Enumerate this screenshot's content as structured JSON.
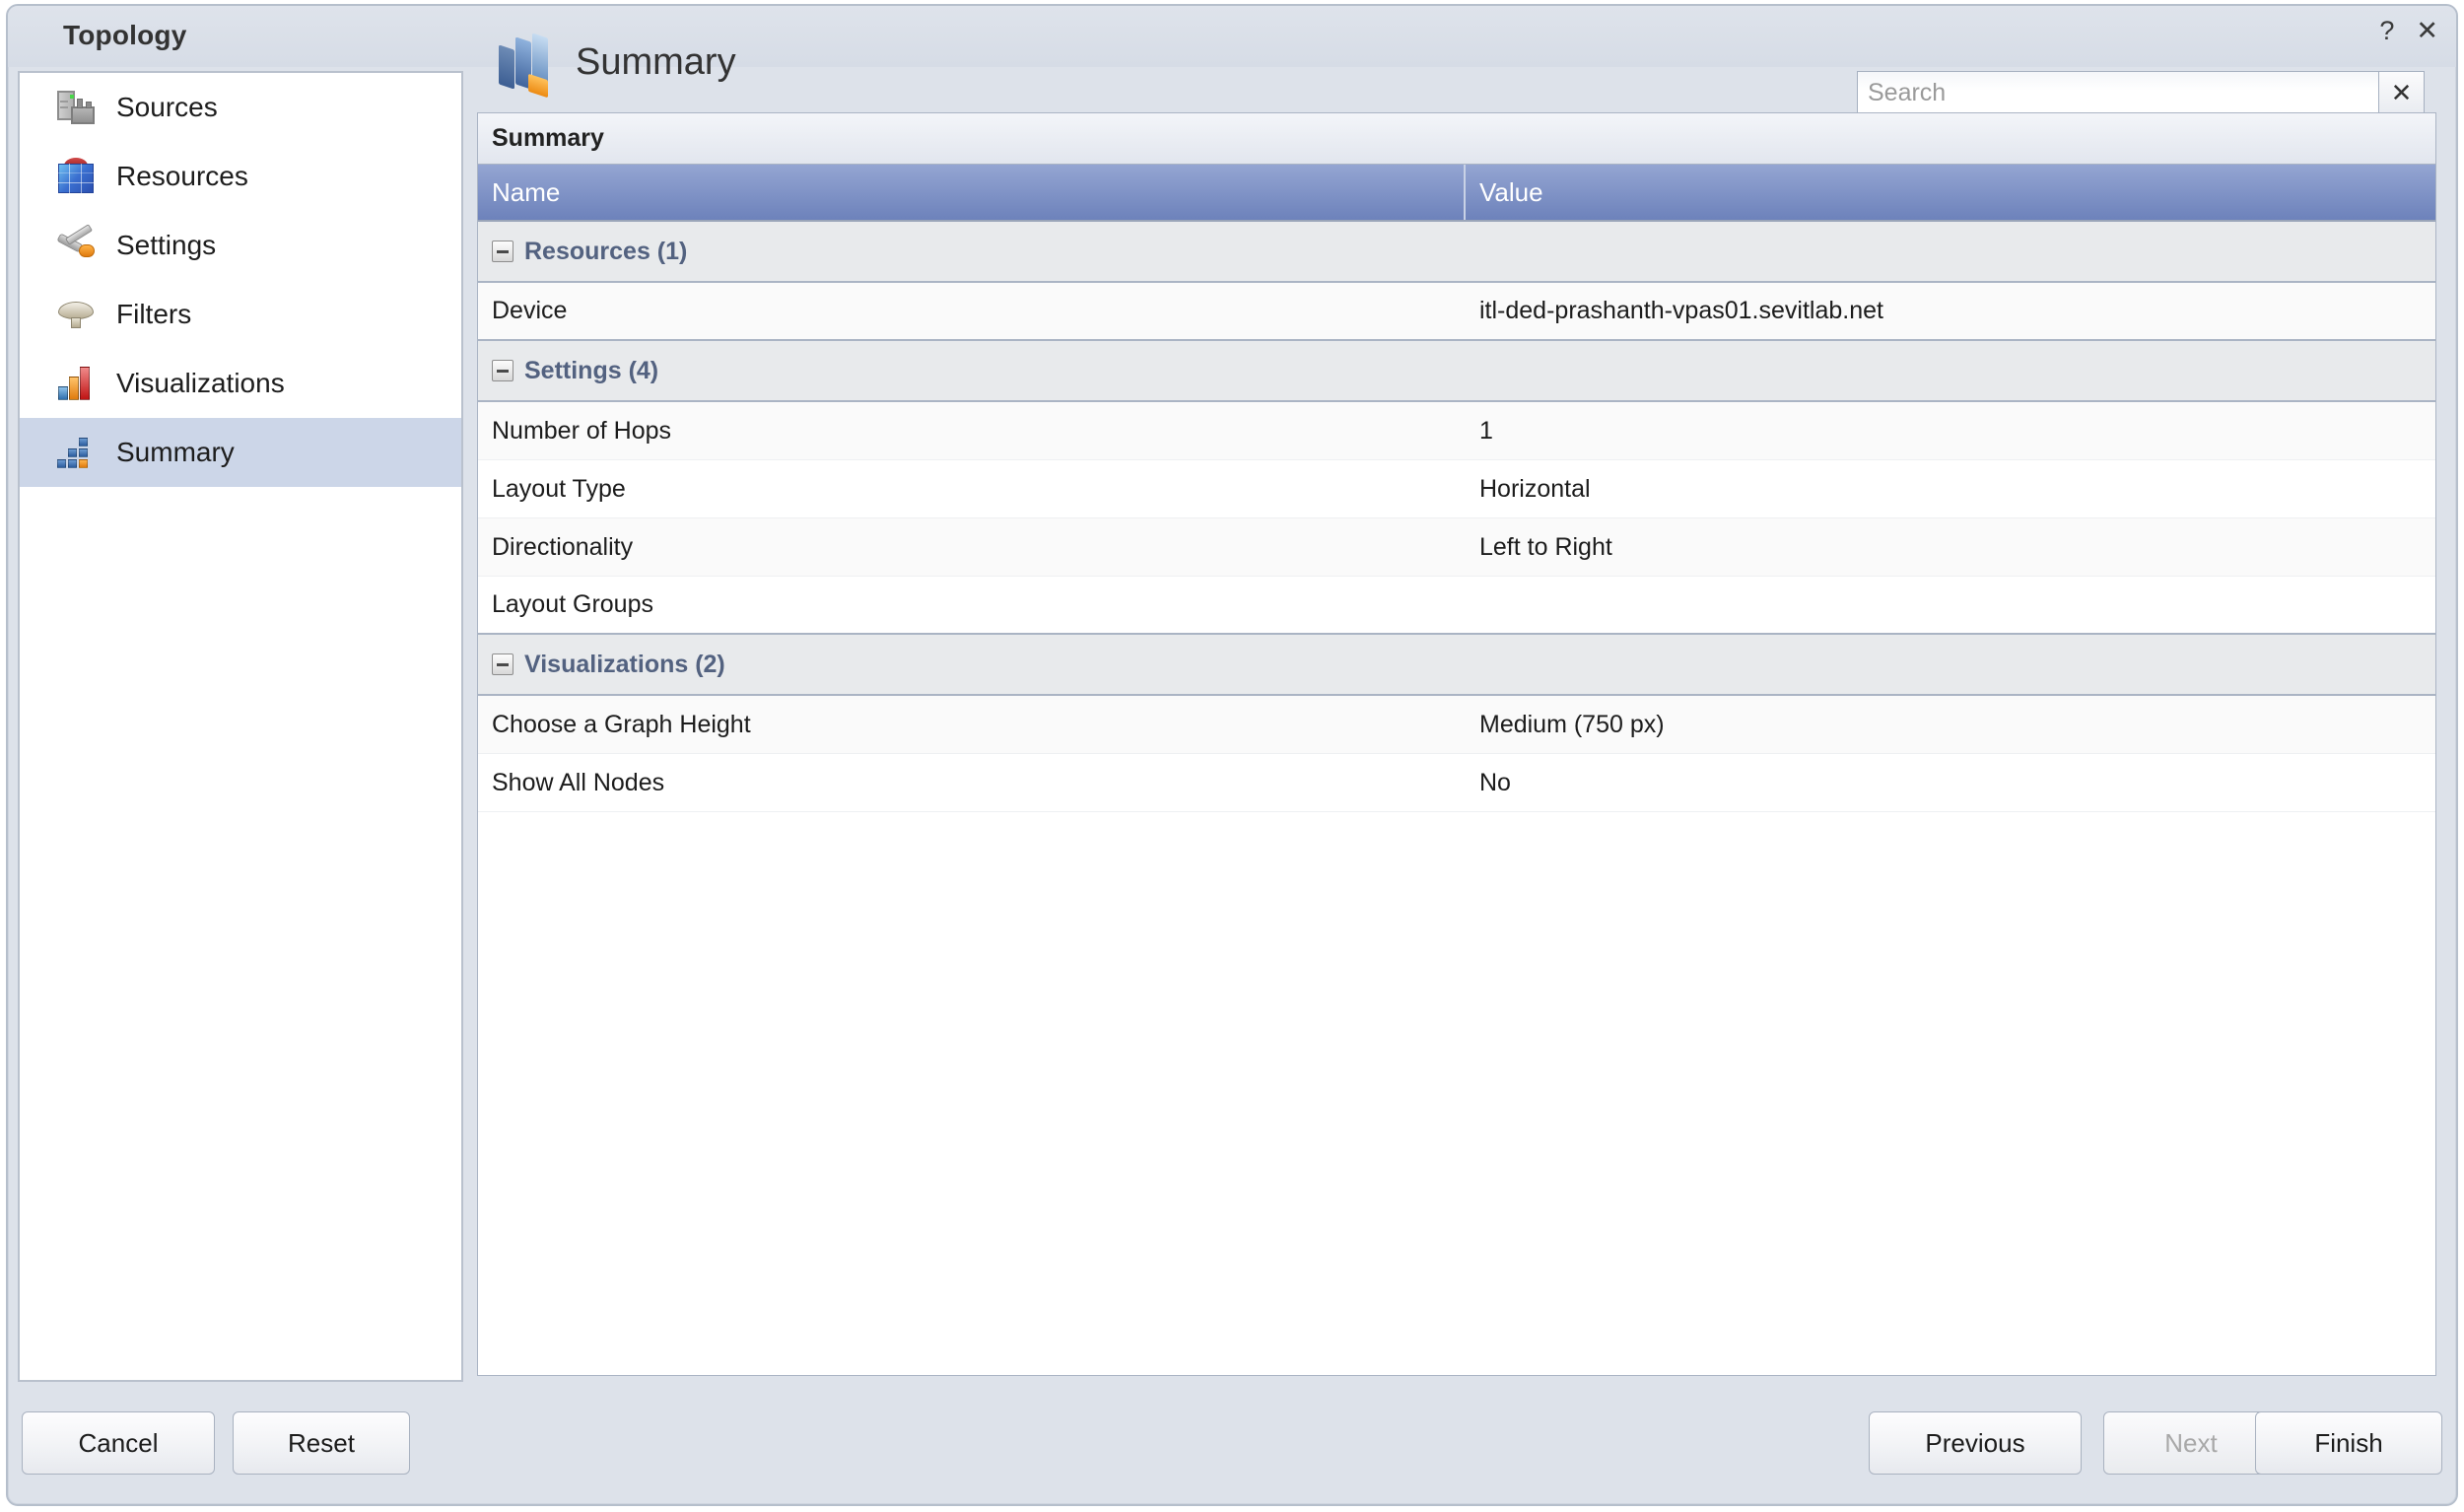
{
  "window": {
    "title": "Topology",
    "help_label": "?",
    "close_label": "✕"
  },
  "sidebar": {
    "items": [
      {
        "label": "Sources",
        "icon": "server-factory-icon",
        "selected": false
      },
      {
        "label": "Resources",
        "icon": "cube-icon",
        "selected": false
      },
      {
        "label": "Settings",
        "icon": "tools-icon",
        "selected": false
      },
      {
        "label": "Filters",
        "icon": "funnel-icon",
        "selected": false
      },
      {
        "label": "Visualizations",
        "icon": "bar-chart-icon",
        "selected": false
      },
      {
        "label": "Summary",
        "icon": "summary-blocks-icon",
        "selected": true
      }
    ]
  },
  "page": {
    "title": "Summary",
    "logo_icon": "topology-shards-icon"
  },
  "search": {
    "placeholder": "Search",
    "value": "",
    "clear_label": "✕"
  },
  "table": {
    "caption": "Summary",
    "columns": [
      "Name",
      "Value"
    ],
    "groups": [
      {
        "label": "Resources (1)",
        "count": 1,
        "rows": [
          {
            "name": "Device",
            "value": "itl-ded-prashanth-vpas01.sevitlab.net"
          }
        ]
      },
      {
        "label": "Settings (4)",
        "count": 4,
        "rows": [
          {
            "name": "Number of Hops",
            "value": "1"
          },
          {
            "name": "Layout Type",
            "value": "Horizontal"
          },
          {
            "name": "Directionality",
            "value": "Left to Right"
          },
          {
            "name": "Layout Groups",
            "value": ""
          }
        ]
      },
      {
        "label": "Visualizations (2)",
        "count": 2,
        "rows": [
          {
            "name": "Choose a Graph Height",
            "value": "Medium (750 px)"
          },
          {
            "name": "Show All Nodes",
            "value": "No"
          }
        ]
      }
    ]
  },
  "footer": {
    "cancel": "Cancel",
    "reset": "Reset",
    "previous": "Previous",
    "next": "Next",
    "finish": "Finish",
    "next_disabled": true
  },
  "colors": {
    "dialog_bg": "#dde2ea",
    "header_blue_top": "#94a5d2",
    "header_blue_bottom": "#6d82bb",
    "group_header_bg": "#e8eaec",
    "group_label": "#536280",
    "selected_nav": "#ccd6e8",
    "accent_orange": "#e07b0e"
  }
}
